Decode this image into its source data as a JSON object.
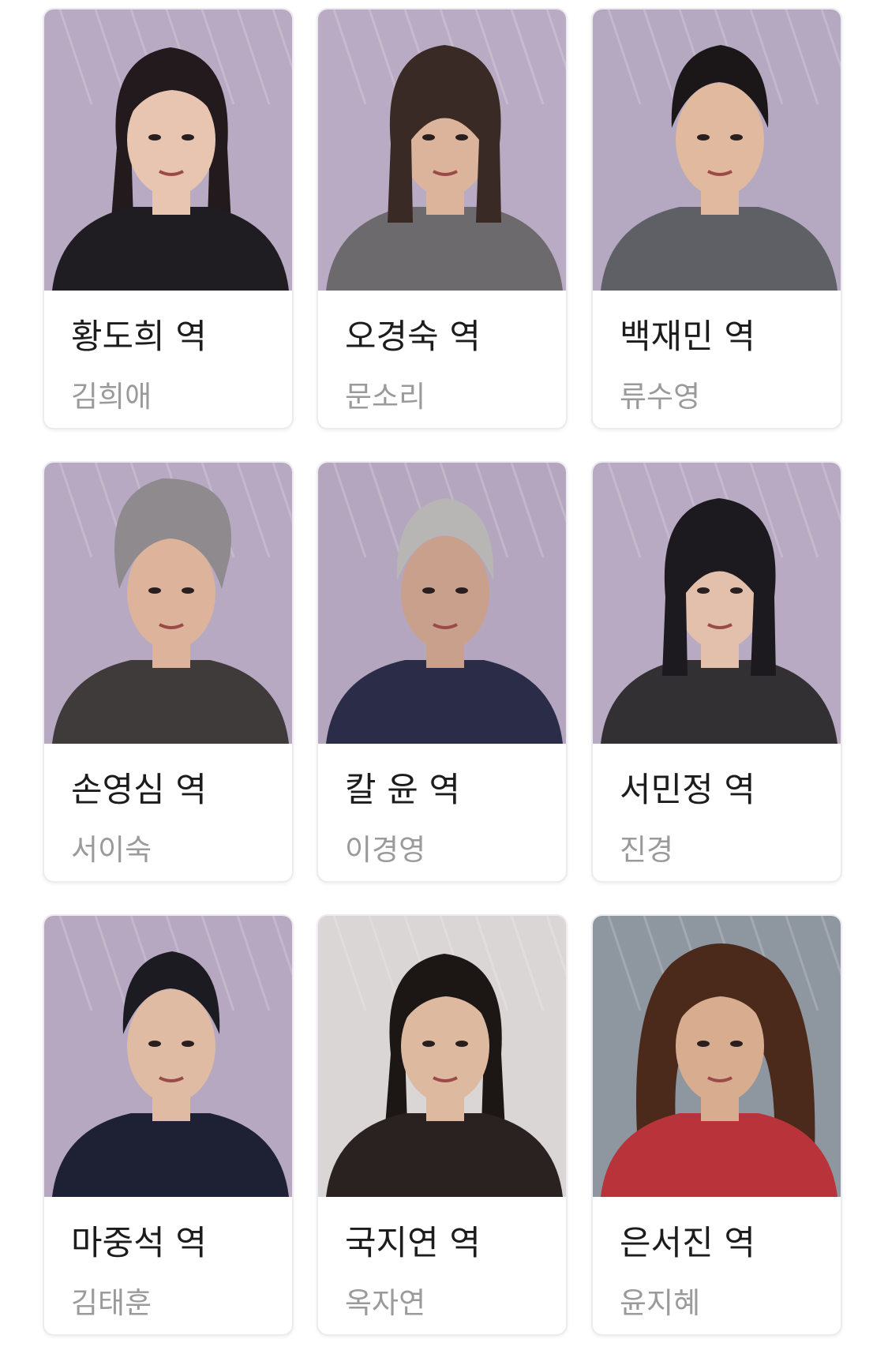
{
  "cast": [
    {
      "role": "황도희 역",
      "actor": "김희애",
      "bg": "#b7aac2",
      "skin": "#e7c5b0",
      "hair": "#221a1c",
      "cloth": "#1f1d22",
      "hair_style": "long"
    },
    {
      "role": "오경숙 역",
      "actor": "문소리",
      "bg": "#b9abc4",
      "skin": "#dcb49b",
      "hair": "#3a2a25",
      "cloth": "#6c6a6c",
      "hair_style": "bob"
    },
    {
      "role": "백재민 역",
      "actor": "류수영",
      "bg": "#b5a8c1",
      "skin": "#e0b99e",
      "hair": "#1b1719",
      "cloth": "#5f6066",
      "hair_style": "short"
    },
    {
      "role": "손영심 역",
      "actor": "서이숙",
      "bg": "#b6a9c1",
      "skin": "#ddb39b",
      "hair": "#8e8a8d",
      "cloth": "#3f3b3a",
      "hair_style": "updo"
    },
    {
      "role": "칼 윤 역",
      "actor": "이경영",
      "bg": "#b4a6bf",
      "skin": "#c9a08c",
      "hair": "#b8b6b4",
      "cloth": "#2a2c48",
      "hair_style": "short"
    },
    {
      "role": "서민정 역",
      "actor": "진경",
      "bg": "#b8aac3",
      "skin": "#e3c0ab",
      "hair": "#1d1a1f",
      "cloth": "#333033",
      "hair_style": "bob"
    },
    {
      "role": "마중석 역",
      "actor": "김태훈",
      "bg": "#b5a8c0",
      "skin": "#dfbba3",
      "hair": "#1d1b22",
      "cloth": "#1e2033",
      "hair_style": "short"
    },
    {
      "role": "국지연 역",
      "actor": "옥자연",
      "bg": "#d9d6d5",
      "skin": "#ddb9a0",
      "hair": "#1c1614",
      "cloth": "#2a2221",
      "hair_style": "long"
    },
    {
      "role": "은서진 역",
      "actor": "윤지혜",
      "bg": "#8e969f",
      "skin": "#d8ad8f",
      "hair": "#4b2a1c",
      "cloth": "#b8343a",
      "hair_style": "wild"
    }
  ]
}
